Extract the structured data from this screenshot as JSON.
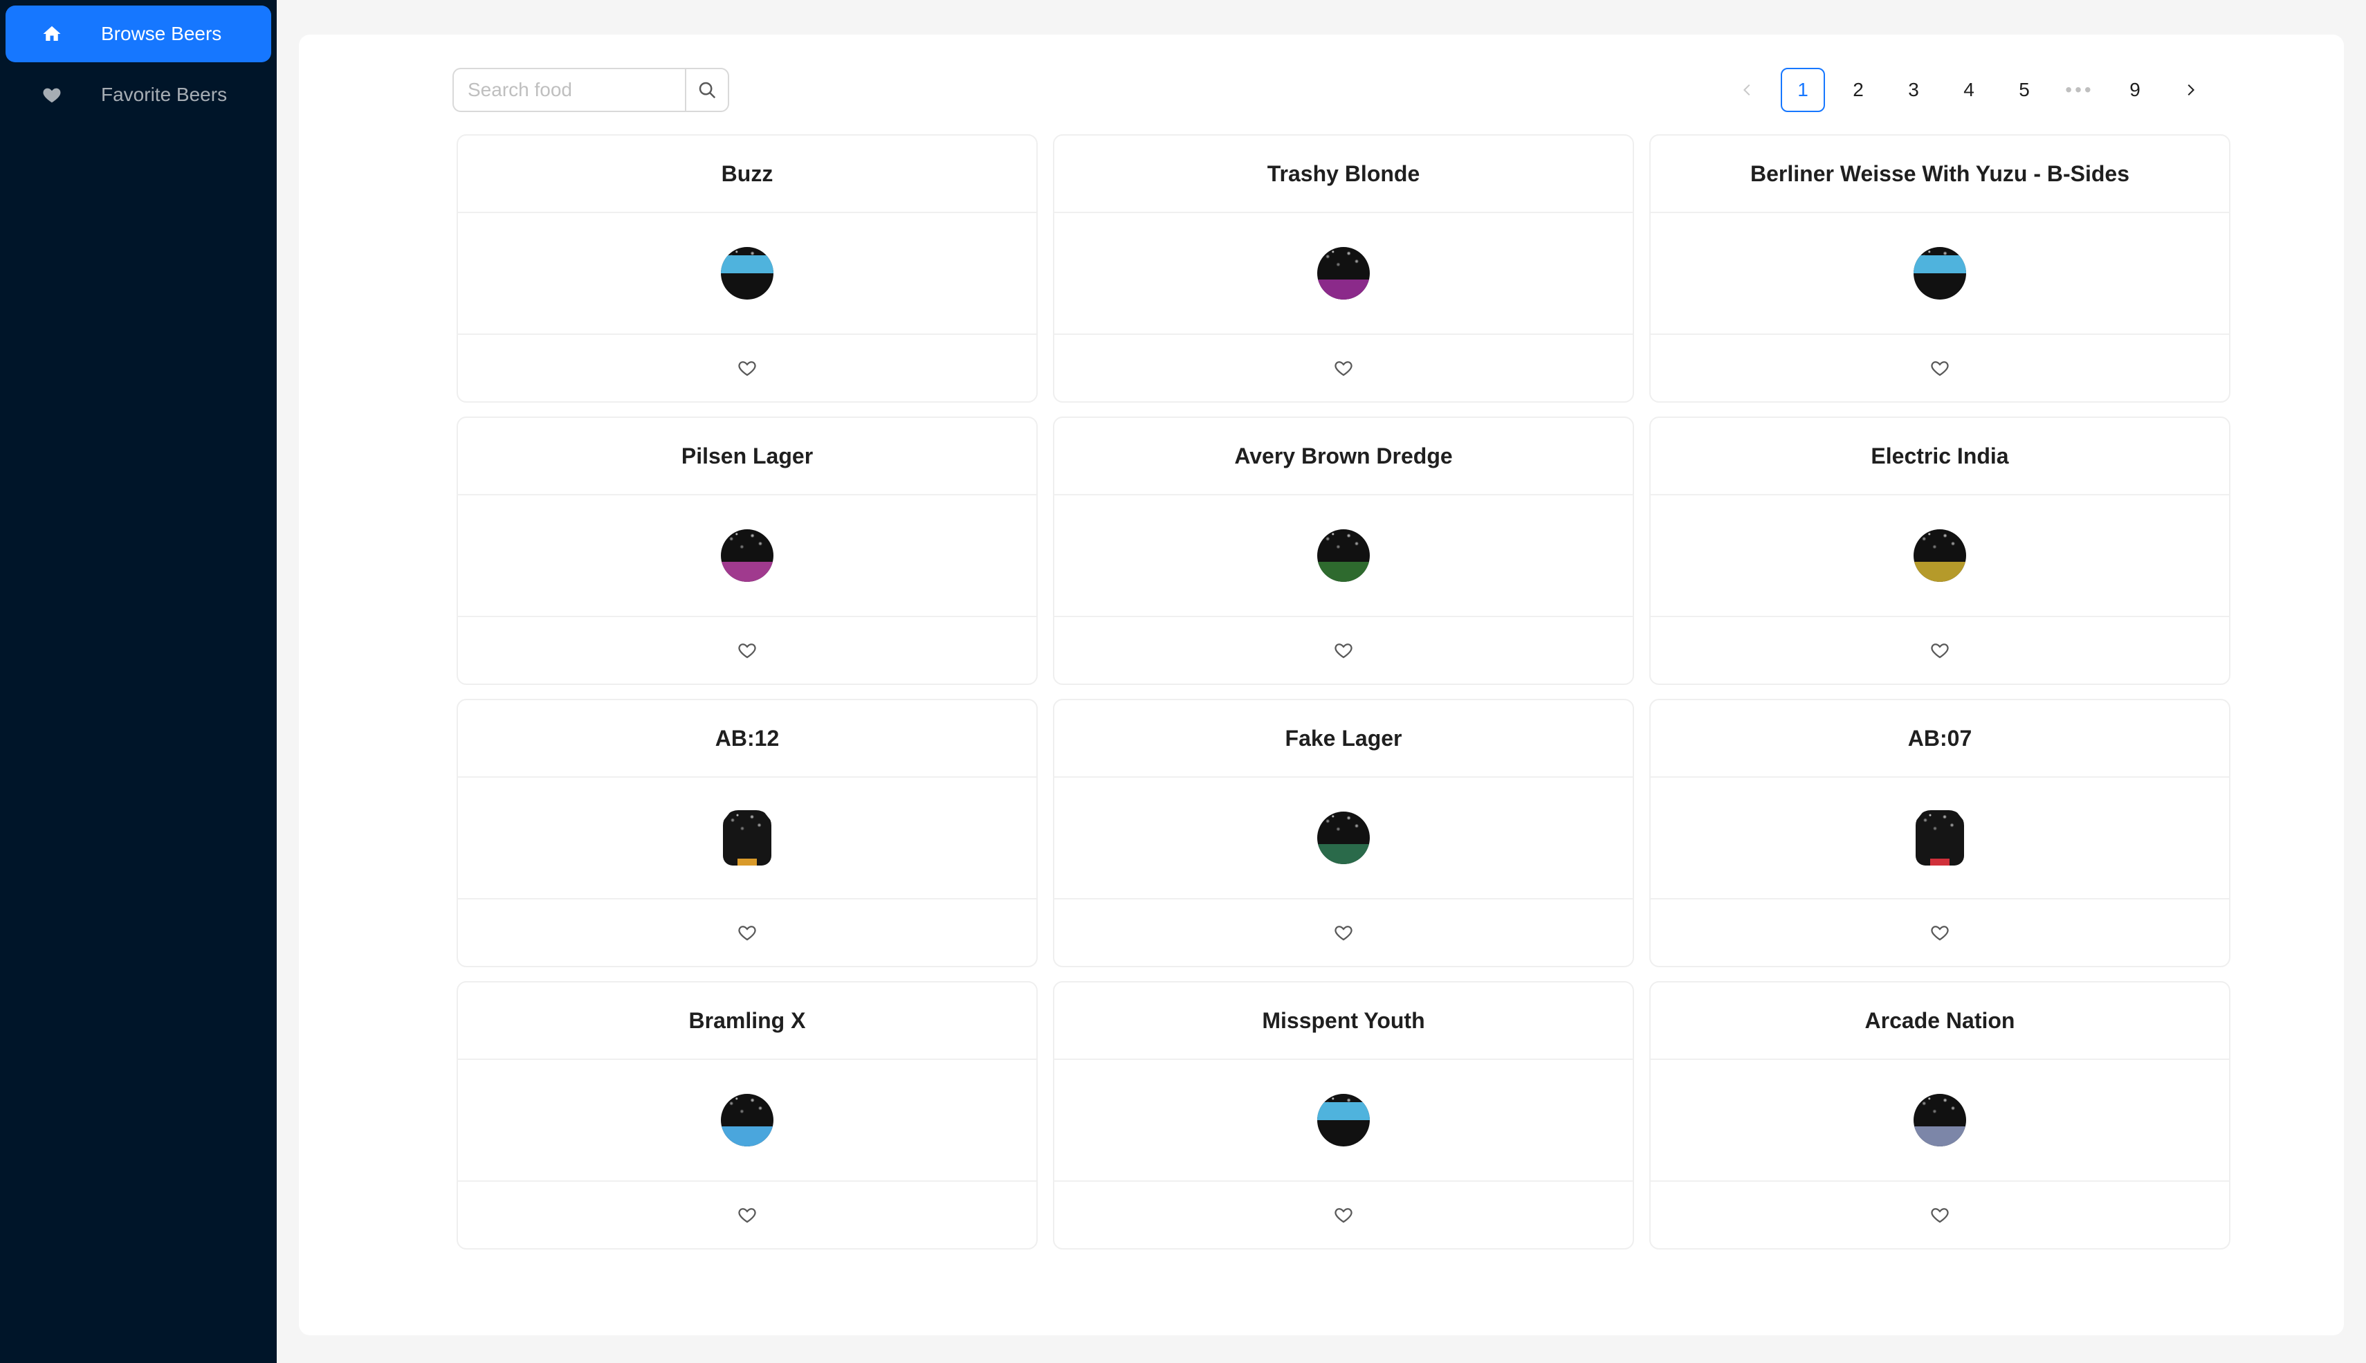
{
  "sidebar": {
    "items": [
      {
        "label": "Browse Beers",
        "icon": "home-icon",
        "active": true
      },
      {
        "label": "Favorite Beers",
        "icon": "heart-icon",
        "active": false
      }
    ]
  },
  "search": {
    "placeholder": "Search food",
    "value": ""
  },
  "pagination": {
    "pages": [
      "1",
      "2",
      "3",
      "4",
      "5",
      "9"
    ],
    "current": "1",
    "ellipsis": "•••"
  },
  "colors": {
    "accent": "#1677ff",
    "sidebar_bg": "#001529"
  },
  "beers": [
    {
      "name": "Buzz",
      "thumb_color": "#4fb3dd",
      "thumb_style": "top-band"
    },
    {
      "name": "Trashy Blonde",
      "thumb_color": "#8b2a8a",
      "thumb_style": "bottom-band"
    },
    {
      "name": "Berliner Weisse With Yuzu - B-Sides",
      "thumb_color": "#4fb3dd",
      "thumb_style": "top-band"
    },
    {
      "name": "Pilsen Lager",
      "thumb_color": "#a03a8e",
      "thumb_style": "bottom-band"
    },
    {
      "name": "Avery Brown Dredge",
      "thumb_color": "#2e6a2e",
      "thumb_style": "bottom-band"
    },
    {
      "name": "Electric India",
      "thumb_color": "#b59a2a",
      "thumb_style": "bottom-band"
    },
    {
      "name": "AB:12",
      "thumb_color": "#d99a2a",
      "thumb_style": "keg"
    },
    {
      "name": "Fake Lager",
      "thumb_color": "#2a6a4a",
      "thumb_style": "bottom-band"
    },
    {
      "name": "AB:07",
      "thumb_color": "#d0303a",
      "thumb_style": "keg"
    },
    {
      "name": "Bramling X",
      "thumb_color": "#4aa6dd",
      "thumb_style": "bottom-band"
    },
    {
      "name": "Misspent Youth",
      "thumb_color": "#4fb3dd",
      "thumb_style": "top-band"
    },
    {
      "name": "Arcade Nation",
      "thumb_color": "#7c86a8",
      "thumb_style": "bottom-band"
    }
  ]
}
